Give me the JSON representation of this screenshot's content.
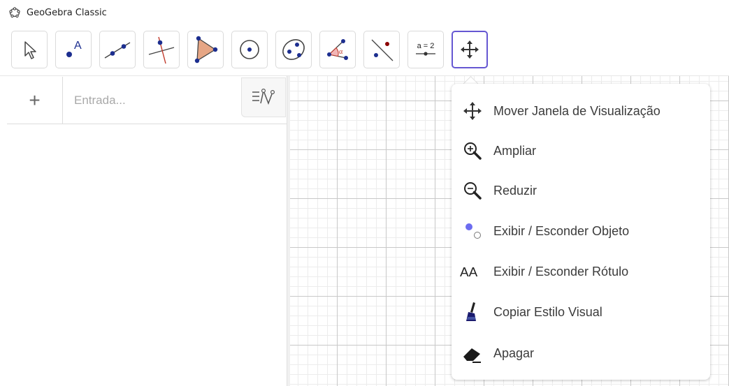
{
  "window": {
    "title": "GeoGebra Classic",
    "icon": "geogebra-logo-icon"
  },
  "toolbar": {
    "tools": [
      {
        "name": "move-tool",
        "icon": "cursor-arrow-icon"
      },
      {
        "name": "point-tool",
        "icon": "point-a-icon",
        "label": "A"
      },
      {
        "name": "line-tool",
        "icon": "line-through-points-icon"
      },
      {
        "name": "perpendicular-tool",
        "icon": "perpendicular-line-icon"
      },
      {
        "name": "polygon-tool",
        "icon": "polygon-icon"
      },
      {
        "name": "circle-center-point-tool",
        "icon": "circle-center-icon"
      },
      {
        "name": "conic-tool",
        "icon": "ellipse-icon"
      },
      {
        "name": "angle-tool",
        "icon": "angle-icon",
        "label": "α"
      },
      {
        "name": "reflect-tool",
        "icon": "reflect-line-icon"
      },
      {
        "name": "slider-tool",
        "icon": "slider-icon",
        "label": "a = 2"
      },
      {
        "name": "move-graphics-view-tool",
        "icon": "move-arrows-icon",
        "selected": true
      }
    ]
  },
  "algebra": {
    "add_label": "+",
    "input_placeholder": "Entrada...",
    "input_value": ""
  },
  "menu": {
    "items": [
      {
        "label": "Mover Janela de Visualização",
        "icon": "move-arrows-icon"
      },
      {
        "label": "Ampliar",
        "icon": "zoom-in-icon"
      },
      {
        "label": "Reduzir",
        "icon": "zoom-out-icon"
      },
      {
        "label": "Exibir / Esconder Objeto",
        "icon": "show-hide-object-icon"
      },
      {
        "label": "Exibir / Esconder Rótulo",
        "icon": "show-hide-label-icon",
        "glyph": "AA"
      },
      {
        "label": "Copiar Estilo Visual",
        "icon": "brush-icon"
      },
      {
        "label": "Apagar",
        "icon": "eraser-icon"
      }
    ]
  },
  "colors": {
    "accent": "#6557d2",
    "point": "#1c2e8f",
    "polygon_fill": "#e6a685",
    "reflect_point": "#8b0000"
  }
}
